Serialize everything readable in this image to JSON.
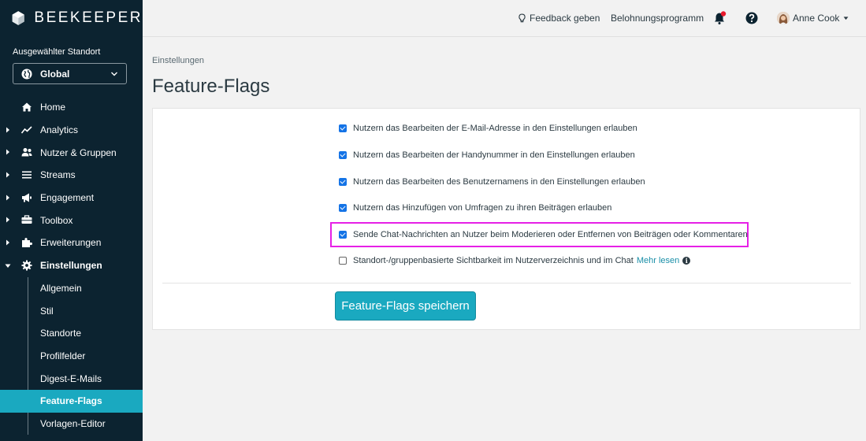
{
  "app": {
    "logo_text": "BEEKEEPER"
  },
  "location": {
    "label": "Ausgewählter Standort",
    "value": "Global"
  },
  "nav": {
    "items": [
      {
        "label": "Home",
        "icon": "home-icon"
      },
      {
        "label": "Analytics",
        "icon": "analytics-icon"
      },
      {
        "label": "Nutzer & Gruppen",
        "icon": "users-icon"
      },
      {
        "label": "Streams",
        "icon": "streams-icon"
      },
      {
        "label": "Engagement",
        "icon": "megaphone-icon"
      },
      {
        "label": "Toolbox",
        "icon": "toolbox-icon"
      },
      {
        "label": "Erweiterungen",
        "icon": "puzzle-icon"
      },
      {
        "label": "Einstellungen",
        "icon": "gear-icon"
      }
    ],
    "sub_items": [
      {
        "label": "Allgemein"
      },
      {
        "label": "Stil"
      },
      {
        "label": "Standorte"
      },
      {
        "label": "Profilfelder"
      },
      {
        "label": "Digest-E-Mails"
      },
      {
        "label": "Feature-Flags",
        "active": true
      },
      {
        "label": "Vorlagen-Editor"
      }
    ]
  },
  "header": {
    "feedback": "Feedback geben",
    "rewards": "Belohnungsprogramm",
    "user_name": "Anne Cook",
    "notification_color": "#e8192c"
  },
  "breadcrumb": "Einstellungen",
  "page_title": "Feature-Flags",
  "flags": [
    {
      "label": "Nutzern das Bearbeiten der E-Mail-Adresse in den Einstellungen erlauben",
      "checked": true
    },
    {
      "label": "Nutzern das Bearbeiten der Handynummer in den Einstellungen erlauben",
      "checked": true
    },
    {
      "label": "Nutzern das Bearbeiten des Benutzernamens in den Einstellungen erlauben",
      "checked": true
    },
    {
      "label": "Nutzern das Hinzufügen von Umfragen zu ihren Beiträgen erlauben",
      "checked": true
    },
    {
      "label": "Sende Chat-Nachrichten an Nutzer beim Moderieren oder Entfernen von Beiträgen oder Kommentaren",
      "checked": true,
      "highlighted": true
    },
    {
      "label": "Standort-/gruppenbasierte Sichtbarkeit im Nutzerverzeichnis und im Chat",
      "checked": false,
      "link": "Mehr lesen"
    }
  ],
  "save_button": "Feature-Flags speichern",
  "colors": {
    "accent": "#1aa9c0",
    "sidebar": "#0c2330",
    "highlight": "#e620e6",
    "checkbox": "#1473e6"
  }
}
